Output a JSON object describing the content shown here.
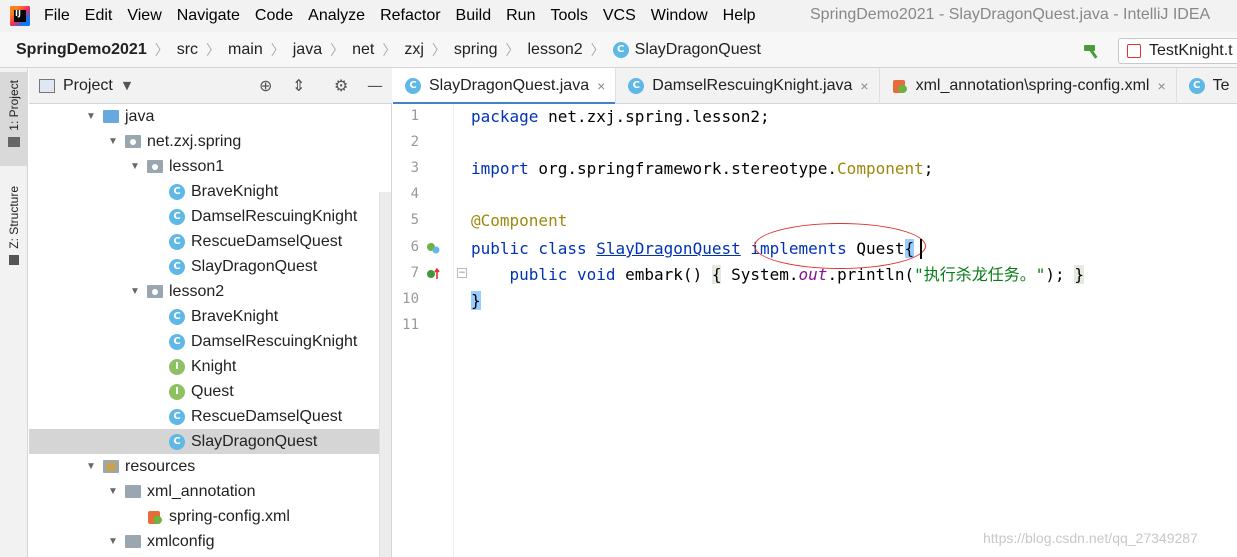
{
  "menubar": {
    "items": [
      {
        "label": "File"
      },
      {
        "label": "Edit"
      },
      {
        "label": "View"
      },
      {
        "label": "Navigate"
      },
      {
        "label": "Code"
      },
      {
        "label": "Analyze"
      },
      {
        "label": "Refactor"
      },
      {
        "label": "Build"
      },
      {
        "label": "Run"
      },
      {
        "label": "Tools"
      },
      {
        "label": "VCS"
      },
      {
        "label": "Window"
      },
      {
        "label": "Help"
      }
    ],
    "window_title": "SpringDemo2021 - SlayDragonQuest.java - IntelliJ IDEA"
  },
  "navbar": {
    "crumbs": [
      "SpringDemo2021",
      "src",
      "main",
      "java",
      "net",
      "zxj",
      "spring",
      "lesson2",
      "SlayDragonQuest"
    ],
    "run_config": "TestKnight.t"
  },
  "left_stripe": {
    "project": "1: Project",
    "structure": "Z: Structure"
  },
  "project_panel": {
    "title": "Project",
    "tree": [
      {
        "label": "java",
        "depth": 0,
        "type": "folder-blue",
        "expanded": true
      },
      {
        "label": "net.zxj.spring",
        "depth": 1,
        "type": "package",
        "expanded": true
      },
      {
        "label": "lesson1",
        "depth": 2,
        "type": "package",
        "expanded": true
      },
      {
        "label": "BraveKnight",
        "depth": 3,
        "type": "class"
      },
      {
        "label": "DamselRescuingKnight",
        "depth": 3,
        "type": "class"
      },
      {
        "label": "RescueDamselQuest",
        "depth": 3,
        "type": "class"
      },
      {
        "label": "SlayDragonQuest",
        "depth": 3,
        "type": "class"
      },
      {
        "label": "lesson2",
        "depth": 2,
        "type": "package",
        "expanded": true
      },
      {
        "label": "BraveKnight",
        "depth": 3,
        "type": "class"
      },
      {
        "label": "DamselRescuingKnight",
        "depth": 3,
        "type": "class"
      },
      {
        "label": "Knight",
        "depth": 3,
        "type": "interface"
      },
      {
        "label": "Quest",
        "depth": 3,
        "type": "interface"
      },
      {
        "label": "RescueDamselQuest",
        "depth": 3,
        "type": "class"
      },
      {
        "label": "SlayDragonQuest",
        "depth": 3,
        "type": "class",
        "selected": true
      },
      {
        "label": "resources",
        "depth": 0,
        "type": "resources",
        "expanded": true
      },
      {
        "label": "xml_annotation",
        "depth": 1,
        "type": "folder",
        "expanded": true
      },
      {
        "label": "spring-config.xml",
        "depth": 2,
        "type": "xml"
      },
      {
        "label": "xmlconfig",
        "depth": 1,
        "type": "folder",
        "expanded": true
      }
    ]
  },
  "editor": {
    "tabs": [
      {
        "label": "SlayDragonQuest.java",
        "icon": "class",
        "active": true,
        "closable": true
      },
      {
        "label": "DamselRescuingKnight.java",
        "icon": "class",
        "active": false,
        "closable": true
      },
      {
        "label": "xml_annotation\\spring-config.xml",
        "icon": "xml",
        "active": false,
        "closable": true
      },
      {
        "label": "Te",
        "icon": "class",
        "active": false,
        "closable": false
      }
    ],
    "line_numbers": [
      "1",
      "2",
      "3",
      "4",
      "5",
      "6",
      "7",
      "10",
      "11"
    ],
    "code": {
      "l1_kw": "package",
      "l1_rest": " net.zxj.spring.lesson2;",
      "l3_kw": "import",
      "l3_pkg": " org.springframework.stereotype.",
      "l3_ann": "Component",
      "l3_end": ";",
      "l5_ann": "@Component",
      "l6_kw1": "public",
      "l6_kw2": " class ",
      "l6_cls": "SlayDragonQuest",
      "l6_kw3": " implements",
      "l6_iface": " Quest",
      "l6_brace": "{",
      "l7_indent": "    ",
      "l7_kw1": "public",
      "l7_kw2": " void",
      "l7_method": " embark() ",
      "l7_ob": "{",
      "l7_sys": " System.",
      "l7_out": "out",
      "l7_println": ".println(",
      "l7_str": "\"执行杀龙任务。\"",
      "l7_end": "); ",
      "l7_cb": "}",
      "l10_brace": "}"
    }
  },
  "watermark": "https://blog.csdn.net/qq_27349287",
  "colors": {
    "keyword": "#0033b3",
    "annotation": "#9e880d",
    "string": "#067d17",
    "static_field": "#871094",
    "selection": "#d5d5d5",
    "tab_underline": "#4083c9",
    "highlight_ellipse": "#e03030"
  }
}
